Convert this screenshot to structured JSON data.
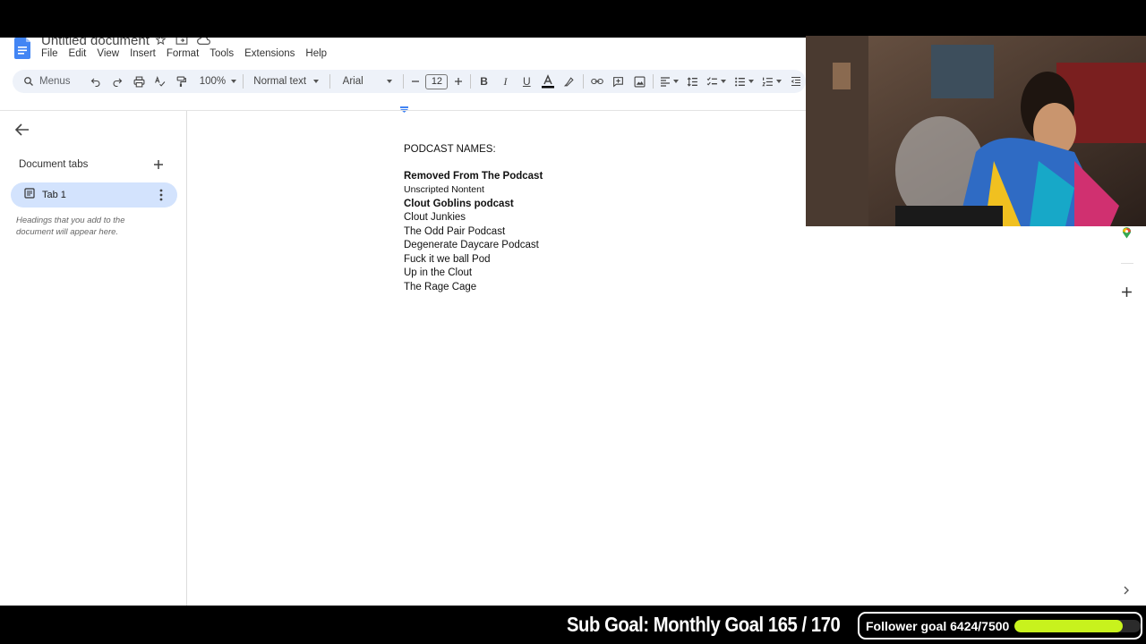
{
  "docs": {
    "title": "Untitled document",
    "menu": [
      "File",
      "Edit",
      "View",
      "Insert",
      "Format",
      "Tools",
      "Extensions",
      "Help"
    ],
    "toolbar": {
      "search_label": "Menus",
      "zoom": "100%",
      "style": "Normal text",
      "font": "Arial",
      "font_size": "12"
    },
    "sidebar": {
      "heading": "Document tabs",
      "tabs": [
        {
          "label": "Tab 1"
        }
      ],
      "hint": "Headings that you add to the document will appear here."
    },
    "body": {
      "heading": "PODCAST NAMES:",
      "lines": [
        {
          "text": "Removed From The Podcast",
          "bold": true
        },
        {
          "text": "Unscripted Nontent",
          "bold": false
        },
        {
          "text": "Clout Goblins podcast",
          "bold": true
        },
        {
          "text": "Clout Junkies",
          "bold": false
        },
        {
          "text": "The Odd Pair Podcast",
          "bold": false
        },
        {
          "text": "Degenerate Daycare Podcast",
          "bold": false
        },
        {
          "text": "Fuck it we ball Pod",
          "bold": false
        },
        {
          "text": "Up in the Clout",
          "bold": false
        },
        {
          "text": "The Rage Cage",
          "bold": false
        }
      ]
    }
  },
  "stream": {
    "sub_goal": "Sub Goal: Monthly Goal  165 / 170",
    "follower_goal_label": "Follower goal 6424/7500",
    "follower_current": 6424,
    "follower_target": 7500,
    "follower_bar_color": "#c8f21d"
  },
  "colors": {
    "docs_blue": "#4285f4",
    "tab_selected": "#d3e3fd",
    "toolbar_bg": "#eef2f9"
  }
}
